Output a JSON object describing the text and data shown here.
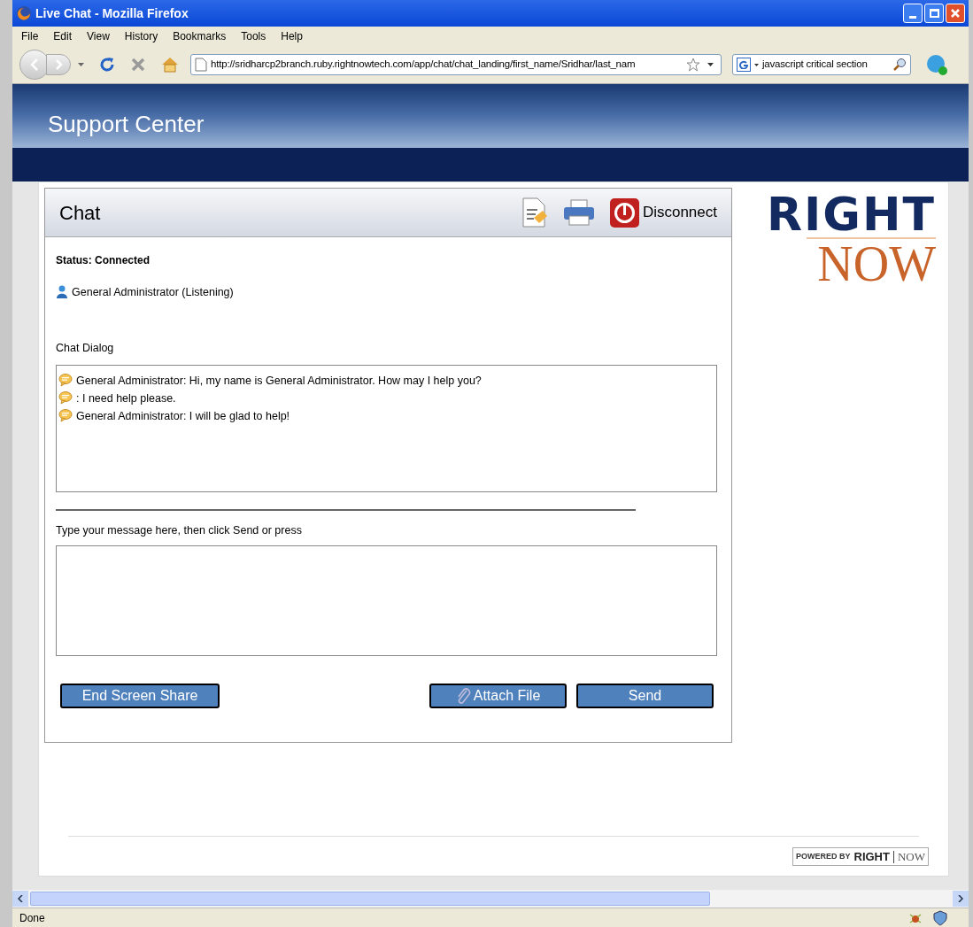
{
  "window": {
    "title": "Live Chat - Mozilla Firefox"
  },
  "menu": [
    "File",
    "Edit",
    "View",
    "History",
    "Bookmarks",
    "Tools",
    "Help"
  ],
  "address_bar": {
    "value": "http://sridharcp2branch.ruby.rightnowtech.com/app/chat/chat_landing/first_name/Sridhar/last_nam"
  },
  "search_bar": {
    "value": "javascript critical section"
  },
  "header": {
    "title": "Support Center"
  },
  "chat": {
    "title": "Chat",
    "disconnect": "Disconnect",
    "status": "Status: Connected",
    "participant": "General Administrator (Listening)",
    "dialog_label": "Chat Dialog",
    "messages": [
      "General Administrator: Hi, my name is General Administrator. How may I help you?",
      ": I need help please.",
      "General Administrator: I will be glad to help!"
    ],
    "input_label": "Type your message here, then click Send or press",
    "buttons": {
      "end_share": "End Screen Share",
      "attach": "Attach File",
      "send": "Send"
    }
  },
  "logo": {
    "top": "RIGHT",
    "bottom": "NOW"
  },
  "powered_by": {
    "prefix": "POWERED BY",
    "brand1": "RIGHT",
    "brand2": "NOW"
  },
  "status_bar": {
    "text": "Done"
  }
}
